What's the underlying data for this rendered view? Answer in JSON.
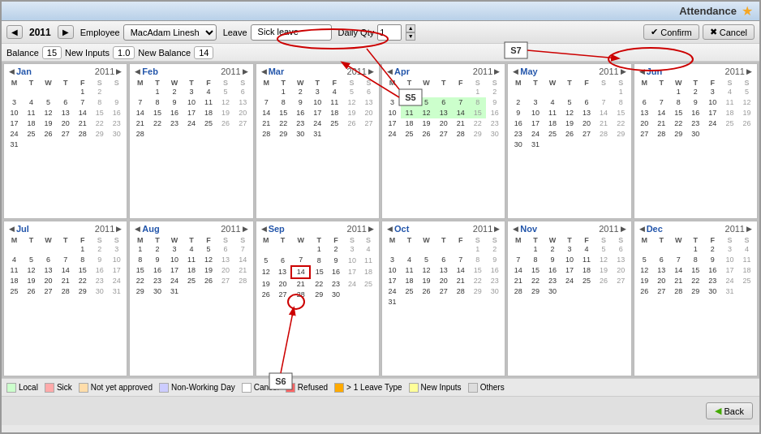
{
  "app": {
    "title": "Attendance",
    "star": "★"
  },
  "toolbar": {
    "year": "2011",
    "prev_label": "◀",
    "next_label": "▶",
    "employee_label": "Employee",
    "employee_value": "MacAdam Linesh",
    "leave_label": "Leave",
    "leave_type": "Sick leave",
    "daily_qty_label": "Daily Qty",
    "daily_qty_value": "1",
    "confirm_label": "Confirm",
    "cancel_label": "Cancel"
  },
  "balance": {
    "balance_label": "Balance",
    "balance_value": "15",
    "new_inputs_label": "New Inputs",
    "new_inputs_value": "1.0",
    "new_balance_label": "New Balance",
    "new_balance_value": "14"
  },
  "legend": {
    "items": [
      {
        "label": "Local",
        "color": "#ccffcc"
      },
      {
        "label": "Sick",
        "color": "#ffaaaa"
      },
      {
        "label": "Not yet approved",
        "color": "#ffddaa"
      },
      {
        "label": "Non-Working Day",
        "color": "#ccccff"
      },
      {
        "label": "Cancel",
        "color": "#ffffff"
      },
      {
        "label": "Refused",
        "color": "#ff6666"
      },
      {
        "label": "> 1 Leave Type",
        "color": "#ffaa00"
      },
      {
        "label": "New Inputs",
        "color": "#ffff99"
      },
      {
        "label": "Others",
        "color": "#dddddd"
      }
    ]
  },
  "annotations": {
    "s5": "S5",
    "s6": "S6",
    "s7": "S7"
  },
  "bottom": {
    "back_label": "Back"
  },
  "months": [
    {
      "name": "Jan",
      "year": "2011",
      "weeks": [
        [
          "",
          "",
          "",
          "",
          "1",
          "2"
        ],
        [
          "3",
          "4",
          "5",
          "6",
          "7",
          "8",
          "9"
        ],
        [
          "10",
          "11",
          "12",
          "13",
          "14",
          "15",
          "16"
        ],
        [
          "17",
          "18",
          "19",
          "20",
          "21",
          "22",
          "23"
        ],
        [
          "24",
          "25",
          "26",
          "27",
          "28",
          "29",
          "30"
        ],
        [
          "31"
        ]
      ]
    },
    {
      "name": "Feb",
      "year": "2011",
      "weeks": [
        [
          "",
          "1",
          "2",
          "3",
          "4",
          "5",
          "6"
        ],
        [
          "7",
          "8",
          "9",
          "10",
          "11",
          "12",
          "13"
        ],
        [
          "14",
          "15",
          "16",
          "17",
          "18",
          "19",
          "20"
        ],
        [
          "21",
          "22",
          "23",
          "24",
          "25",
          "26",
          "27"
        ],
        [
          "28"
        ]
      ]
    },
    {
      "name": "Mar",
      "year": "2011",
      "weeks": [
        [
          "",
          "1",
          "2",
          "3",
          "4",
          "5",
          "6"
        ],
        [
          "7",
          "8",
          "9",
          "10",
          "11",
          "12",
          "13"
        ],
        [
          "14",
          "15",
          "16",
          "17",
          "18",
          "19",
          "20"
        ],
        [
          "21",
          "22",
          "23",
          "24",
          "25",
          "26",
          "27"
        ],
        [
          "28",
          "29",
          "30",
          "31"
        ]
      ]
    },
    {
      "name": "Apr",
      "year": "2011",
      "weeks": [
        [
          "",
          "",
          "",
          "",
          "",
          "1",
          "2"
        ],
        [
          "3",
          "4",
          "5",
          "6",
          "7",
          "8",
          "9"
        ],
        [
          "10",
          "11",
          "12",
          "13",
          "14",
          "15",
          "16"
        ],
        [
          "17",
          "18",
          "19",
          "20",
          "21",
          "22",
          "23"
        ],
        [
          "24",
          "25",
          "26",
          "27",
          "28",
          "29",
          "30"
        ]
      ]
    },
    {
      "name": "May",
      "year": "2011",
      "weeks": [
        [
          "",
          "",
          "",
          "",
          "",
          "",
          "1"
        ],
        [
          "2",
          "3",
          "4",
          "5",
          "6",
          "7",
          "8"
        ],
        [
          "9",
          "10",
          "11",
          "12",
          "13",
          "14",
          "15"
        ],
        [
          "16",
          "17",
          "18",
          "19",
          "20",
          "21",
          "22"
        ],
        [
          "23",
          "24",
          "25",
          "26",
          "27",
          "28",
          "29"
        ],
        [
          "30",
          "31"
        ]
      ]
    },
    {
      "name": "Jun",
      "year": "2011",
      "weeks": [
        [
          "",
          "",
          "1",
          "2",
          "3",
          "4",
          "5"
        ],
        [
          "6",
          "7",
          "8",
          "9",
          "10",
          "11",
          "12"
        ],
        [
          "13",
          "14",
          "15",
          "16",
          "17",
          "18",
          "19"
        ],
        [
          "20",
          "21",
          "22",
          "23",
          "24",
          "25",
          "26"
        ],
        [
          "27",
          "28",
          "29",
          "30"
        ]
      ]
    },
    {
      "name": "Jul",
      "year": "2011",
      "weeks": [
        [
          "",
          "",
          "",
          "",
          "1",
          "2",
          "3"
        ],
        [
          "4",
          "5",
          "6",
          "7",
          "8",
          "9",
          "10"
        ],
        [
          "11",
          "12",
          "13",
          "14",
          "15",
          "16",
          "17"
        ],
        [
          "18",
          "19",
          "20",
          "21",
          "22",
          "23",
          "24"
        ],
        [
          "25",
          "26",
          "27",
          "28",
          "29",
          "30",
          "31"
        ]
      ]
    },
    {
      "name": "Aug",
      "year": "2011",
      "weeks": [
        [
          "1",
          "2",
          "3",
          "4",
          "5",
          "6",
          "7"
        ],
        [
          "8",
          "9",
          "10",
          "11",
          "12",
          "13",
          "14"
        ],
        [
          "15",
          "16",
          "17",
          "18",
          "19",
          "20",
          "21"
        ],
        [
          "22",
          "23",
          "24",
          "25",
          "26",
          "27",
          "28"
        ],
        [
          "29",
          "30",
          "31"
        ]
      ]
    },
    {
      "name": "Sep",
      "year": "2011",
      "weeks": [
        [
          "",
          "",
          "",
          "1",
          "2",
          "3",
          "4"
        ],
        [
          "5",
          "6",
          "7",
          "8",
          "9",
          "10",
          "11"
        ],
        [
          "12",
          "13",
          "14",
          "15",
          "16",
          "17",
          "18"
        ],
        [
          "19",
          "20",
          "21",
          "22",
          "23",
          "24",
          "25"
        ],
        [
          "26",
          "27",
          "28",
          "29",
          "30"
        ]
      ]
    },
    {
      "name": "Oct",
      "year": "2011",
      "weeks": [
        [
          "",
          "",
          "",
          "",
          "",
          "1",
          "2"
        ],
        [
          "3",
          "4",
          "5",
          "6",
          "7",
          "8",
          "9"
        ],
        [
          "10",
          "11",
          "12",
          "13",
          "14",
          "15",
          "16"
        ],
        [
          "17",
          "18",
          "19",
          "20",
          "21",
          "22",
          "23"
        ],
        [
          "24",
          "25",
          "26",
          "27",
          "28",
          "29",
          "30"
        ],
        [
          "31"
        ]
      ]
    },
    {
      "name": "Nov",
      "year": "2011",
      "weeks": [
        [
          "",
          "1",
          "2",
          "3",
          "4",
          "5",
          "6"
        ],
        [
          "7",
          "8",
          "9",
          "10",
          "11",
          "12",
          "13"
        ],
        [
          "14",
          "15",
          "16",
          "17",
          "18",
          "19",
          "20"
        ],
        [
          "21",
          "22",
          "23",
          "24",
          "25",
          "26",
          "27"
        ],
        [
          "28",
          "29",
          "30"
        ]
      ]
    },
    {
      "name": "Dec",
      "year": "2011",
      "weeks": [
        [
          "",
          "",
          "",
          "1",
          "2",
          "3",
          "4"
        ],
        [
          "5",
          "6",
          "7",
          "8",
          "9",
          "10",
          "11"
        ],
        [
          "12",
          "13",
          "14",
          "15",
          "16",
          "17",
          "18"
        ],
        [
          "19",
          "20",
          "21",
          "22",
          "23",
          "24",
          "25"
        ],
        [
          "26",
          "27",
          "28",
          "29",
          "30",
          "31"
        ]
      ]
    }
  ]
}
